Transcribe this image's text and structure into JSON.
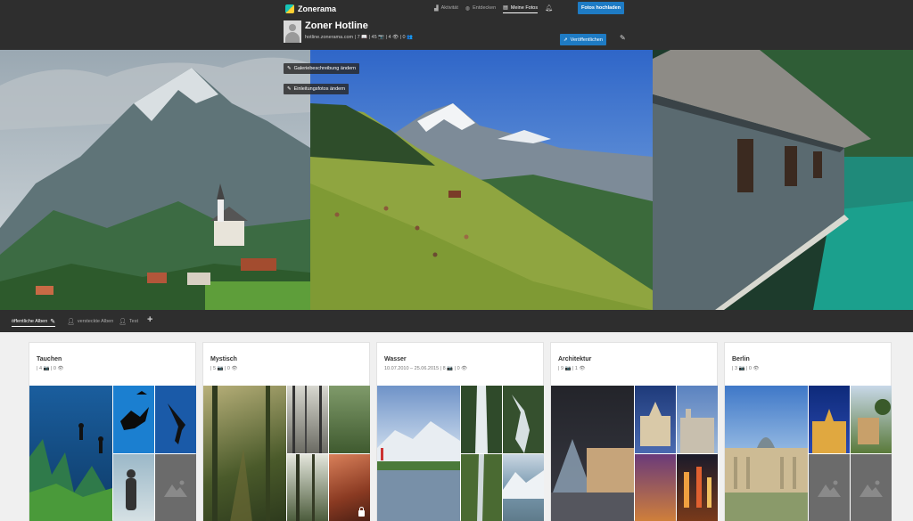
{
  "brand": {
    "name": "Zonerama"
  },
  "topnav": {
    "items": [
      {
        "label": "Aktivität",
        "icon": "activity-icon"
      },
      {
        "label": "Entdecken",
        "icon": "globe-icon"
      },
      {
        "label": "Meine Fotos",
        "icon": "photos-icon",
        "active": true
      }
    ],
    "upload_label": "Fotos hochladen"
  },
  "profile": {
    "name": "Zoner Hotline",
    "stats": "hotline.zonerama.com | 7 📖 | 45 📷 | 4 👁 | 0 👥"
  },
  "actions": {
    "publish_label": "Veröffentlichen",
    "gallery_desc_label": "Galeriebeschreibung ändern",
    "intro_photos_label": "Einleitungsfotos ändern"
  },
  "album_tabs": {
    "items": [
      {
        "label": "öffentliche Alben",
        "active": true
      },
      {
        "label": "versteckte Alben"
      },
      {
        "label": "Test"
      }
    ]
  },
  "albums": [
    {
      "title": "Tauchen",
      "meta": "| 4 📷 | 0 👁"
    },
    {
      "title": "Mystisch",
      "meta": "| 5 📷 | 0 👁"
    },
    {
      "title": "Wasser",
      "meta": "10.07.2010 – 25.06.2015 | 8 📷 | 0 👁"
    },
    {
      "title": "Architektur",
      "meta": "| 9 📷 | 1 👁"
    },
    {
      "title": "Berlin",
      "meta": "| 3 📷 | 0 👁"
    }
  ],
  "colors": {
    "accent": "#1e7bc4",
    "bar": "#2e2e2e",
    "page": "#f0f0f0"
  }
}
